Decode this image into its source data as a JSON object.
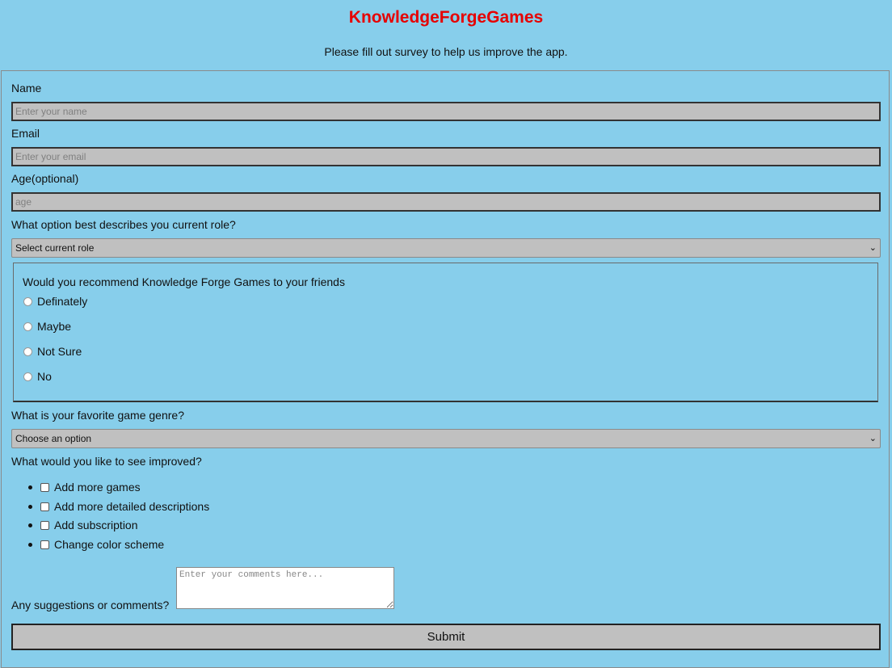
{
  "header": {
    "title": "KnowledgeForgeGames",
    "subtitle": "Please fill out survey to help us improve the app."
  },
  "form": {
    "name": {
      "label": "Name",
      "placeholder": "Enter your name",
      "value": ""
    },
    "email": {
      "label": "Email",
      "placeholder": "Enter your email",
      "value": ""
    },
    "age": {
      "label": "Age(optional)",
      "placeholder": "age",
      "value": ""
    },
    "role": {
      "label": "What option best describes you current role?",
      "selected": "Select current role"
    },
    "recommend": {
      "question": "Would you recommend Knowledge Forge Games to your friends",
      "options": [
        "Definately",
        "Maybe",
        "Not Sure",
        "No"
      ]
    },
    "genre": {
      "label": "What is your favorite game genre?",
      "selected": "Choose an option"
    },
    "improve": {
      "label": "What would you like to see improved?",
      "options": [
        "Add more games",
        "Add more detailed descriptions",
        "Add subscription",
        "Change color scheme"
      ]
    },
    "comments": {
      "label": "Any suggestions or comments?",
      "placeholder": "Enter your comments here..."
    },
    "submit_label": "Submit"
  },
  "colors": {
    "background": "#87ceeb",
    "title": "#e60000",
    "input_bg": "#c0c0c0"
  }
}
